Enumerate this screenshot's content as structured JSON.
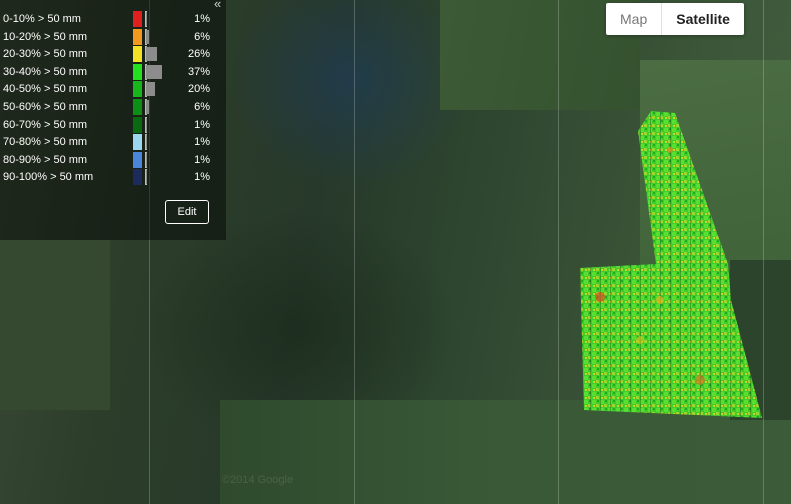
{
  "legend": {
    "collapse_icon": "double-chevron-left-icon",
    "rows": [
      {
        "label": "0-10% > 50 mm",
        "color": "#e01f1f",
        "percent": "1%",
        "fraction": 0.01
      },
      {
        "label": "10-20% > 50 mm",
        "color": "#f39a1e",
        "percent": "6%",
        "fraction": 0.06
      },
      {
        "label": "20-30% > 50 mm",
        "color": "#f2e424",
        "percent": "26%",
        "fraction": 0.26
      },
      {
        "label": "30-40% > 50 mm",
        "color": "#23e021",
        "percent": "37%",
        "fraction": 0.37
      },
      {
        "label": "40-50% > 50 mm",
        "color": "#17b71b",
        "percent": "20%",
        "fraction": 0.2
      },
      {
        "label": "50-60% > 50 mm",
        "color": "#0d8f15",
        "percent": "6%",
        "fraction": 0.06
      },
      {
        "label": "60-70% > 50 mm",
        "color": "#0a6a12",
        "percent": "1%",
        "fraction": 0.01
      },
      {
        "label": "70-80% > 50 mm",
        "color": "#9cd6ef",
        "percent": "1%",
        "fraction": 0.01
      },
      {
        "label": "80-90% > 50 mm",
        "color": "#4a86d9",
        "percent": "1%",
        "fraction": 0.01
      },
      {
        "label": "90-100% > 50 mm",
        "color": "#1c2a5c",
        "percent": "1%",
        "fraction": 0.01
      }
    ],
    "edit_label": "Edit"
  },
  "map_type": {
    "map_label": "Map",
    "satellite_label": "Satellite",
    "selected": "Satellite"
  },
  "watermark": "©2014 Google"
}
